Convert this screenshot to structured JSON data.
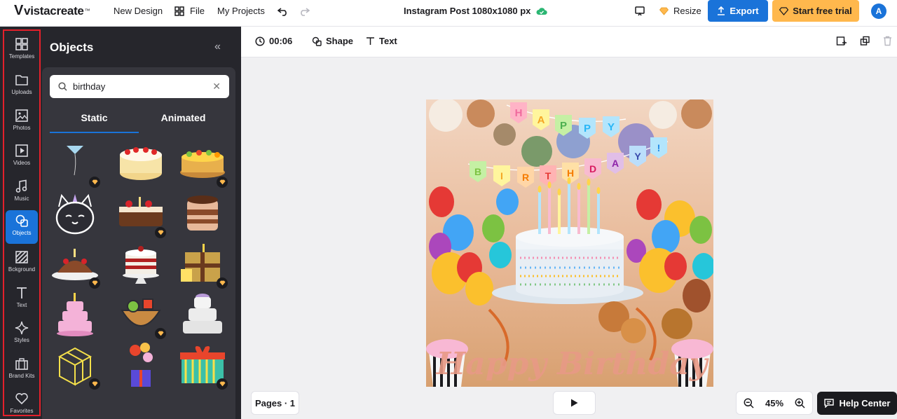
{
  "topbar": {
    "logo": "vistacreate",
    "new_design": "New Design",
    "file": "File",
    "my_projects": "My Projects",
    "doc_title": "Instagram Post 1080x1080 px",
    "resize": "Resize",
    "export": "Export",
    "start_trial": "Start free trial",
    "avatar_initial": "A"
  },
  "rail": {
    "items": [
      {
        "label": "Templates",
        "icon": "grid-icon"
      },
      {
        "label": "Uploads",
        "icon": "folder-icon"
      },
      {
        "label": "Photos",
        "icon": "image-icon"
      },
      {
        "label": "Videos",
        "icon": "video-icon"
      },
      {
        "label": "Music",
        "icon": "music-note-icon"
      },
      {
        "label": "Objects",
        "icon": "shapes-icon"
      },
      {
        "label": "Bckground",
        "icon": "stripes-icon"
      },
      {
        "label": "Text",
        "icon": "text-t-icon"
      },
      {
        "label": "Styles",
        "icon": "sparkle-icon"
      },
      {
        "label": "Brand Kits",
        "icon": "briefcase-icon"
      },
      {
        "label": "Favorites",
        "icon": "heart-icon"
      }
    ]
  },
  "panel": {
    "title": "Objects",
    "search_value": "birthday",
    "tabs": [
      {
        "label": "Static"
      },
      {
        "label": "Animated"
      }
    ]
  },
  "toolbar": {
    "duration": "00:06",
    "shape": "Shape",
    "text": "Text"
  },
  "artboard": {
    "banner_top": [
      "H",
      "A",
      "P",
      "P",
      "Y"
    ],
    "banner_bottom": [
      "B",
      "I",
      "R",
      "T",
      "H",
      "D",
      "A",
      "Y",
      "!"
    ],
    "script_text": "Happy Birthday"
  },
  "bottom": {
    "pages": "Pages · 1",
    "zoom": "45%",
    "help": "Help Center"
  },
  "colors": {
    "accent": "#1a73d9",
    "trial": "#ffb84d",
    "rail_bg": "#26262c",
    "highlight": "#e4202b"
  }
}
